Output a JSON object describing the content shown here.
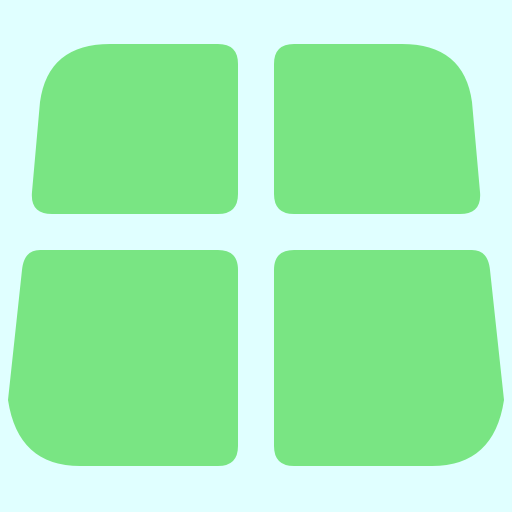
{
  "colors": {
    "background": "#E0FFFF",
    "tile": "#79E583"
  },
  "icon": {
    "name": "windows-logo-icon"
  }
}
